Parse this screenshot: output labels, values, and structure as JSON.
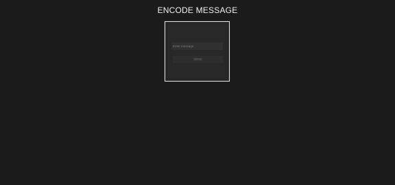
{
  "header": {
    "title": "ENCODE MESSAGE"
  },
  "form": {
    "message_placeholder": "Enter message",
    "message_value": "",
    "submit_label": "SEND"
  }
}
